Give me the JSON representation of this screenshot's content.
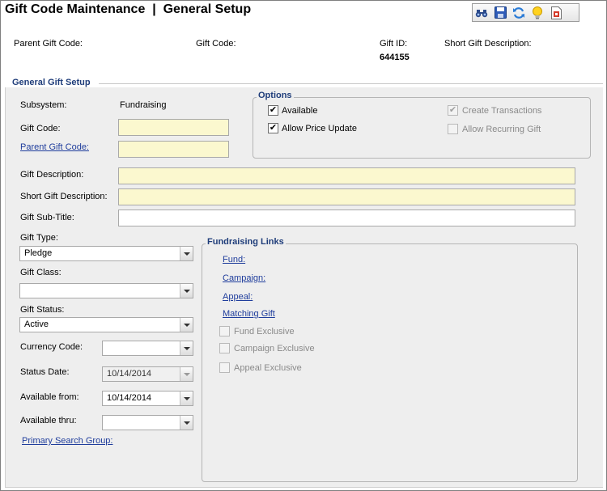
{
  "title": "Gift Code Maintenance  |  General Setup",
  "toolbar": {
    "icons": [
      "binoculars-icon",
      "save-icon",
      "refresh-icon",
      "lightbulb-icon",
      "report-icon"
    ]
  },
  "header": {
    "parent_gift_code_label": "Parent Gift Code:",
    "gift_code_label": "Gift Code:",
    "gift_id_label": "Gift ID:",
    "gift_id_value": "644155",
    "short_desc_label": "Short Gift Description:"
  },
  "general": {
    "section_title": "General Gift Setup",
    "subsystem_label": "Subsystem:",
    "subsystem_value": "Fundraising",
    "gift_code_label": "Gift Code:",
    "gift_code_value": "",
    "parent_gift_code_label": "Parent Gift Code:",
    "parent_gift_code_value": "",
    "gift_description_label": "Gift Description:",
    "gift_description_value": "",
    "short_description_label": "Short Gift Description:",
    "short_description_value": "",
    "sub_title_label": "Gift Sub-Title:",
    "sub_title_value": "",
    "gift_type_label": "Gift Type:",
    "gift_type_value": "Pledge",
    "gift_class_label": "Gift Class:",
    "gift_class_value": "",
    "gift_status_label": "Gift Status:",
    "gift_status_value": "Active",
    "currency_code_label": "Currency Code:",
    "currency_code_value": "",
    "status_date_label": "Status Date:",
    "status_date_value": "10/14/2014",
    "available_from_label": "Available from:",
    "available_from_value": "10/14/2014",
    "available_thru_label": "Available thru:",
    "available_thru_value": "",
    "primary_search_group_label": "Primary Search Group:"
  },
  "options": {
    "title": "Options",
    "available_label": "Available",
    "available_checked": true,
    "allow_price_update_label": "Allow Price Update",
    "allow_price_update_checked": true,
    "create_transactions_label": "Create Transactions",
    "create_transactions_checked": true,
    "allow_recurring_gift_label": "Allow Recurring Gift",
    "allow_recurring_gift_checked": false
  },
  "fundraising_links": {
    "title": "Fundraising Links",
    "fund_label": "Fund:",
    "campaign_label": "Campaign:",
    "appeal_label": "Appeal:",
    "matching_gift_label": "Matching Gift",
    "fund_exclusive_label": "Fund Exclusive",
    "campaign_exclusive_label": "Campaign Exclusive",
    "appeal_exclusive_label": "Appeal Exclusive"
  },
  "check_glyph": "✔"
}
